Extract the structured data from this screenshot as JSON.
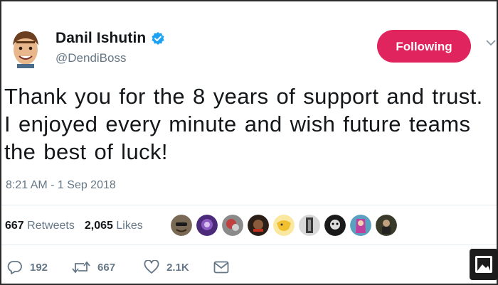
{
  "author": {
    "display_name": "Danil Ishutin",
    "handle": "@DendiBoss",
    "verified_icon": "verified-badge-icon"
  },
  "follow_button": {
    "label": "Following",
    "color": "#e0245e"
  },
  "tweet": {
    "text": "Thank you for the 8 years of support and trust. I enjoyed every minute and wish future teams the best of luck!",
    "timestamp": "8:21 AM - 1 Sep 2018"
  },
  "stats": {
    "retweets_count": "667",
    "retweets_label": "Retweets",
    "likes_count": "2,065",
    "likes_label": "Likes"
  },
  "likers_count_shown": 9,
  "actions": {
    "reply_count": "192",
    "retweet_count": "667",
    "like_count": "2.1K"
  },
  "colors": {
    "primary_text": "#14171a",
    "secondary_text": "#657786",
    "verified_blue": "#1da1f2",
    "divider": "#e6ecf0"
  }
}
